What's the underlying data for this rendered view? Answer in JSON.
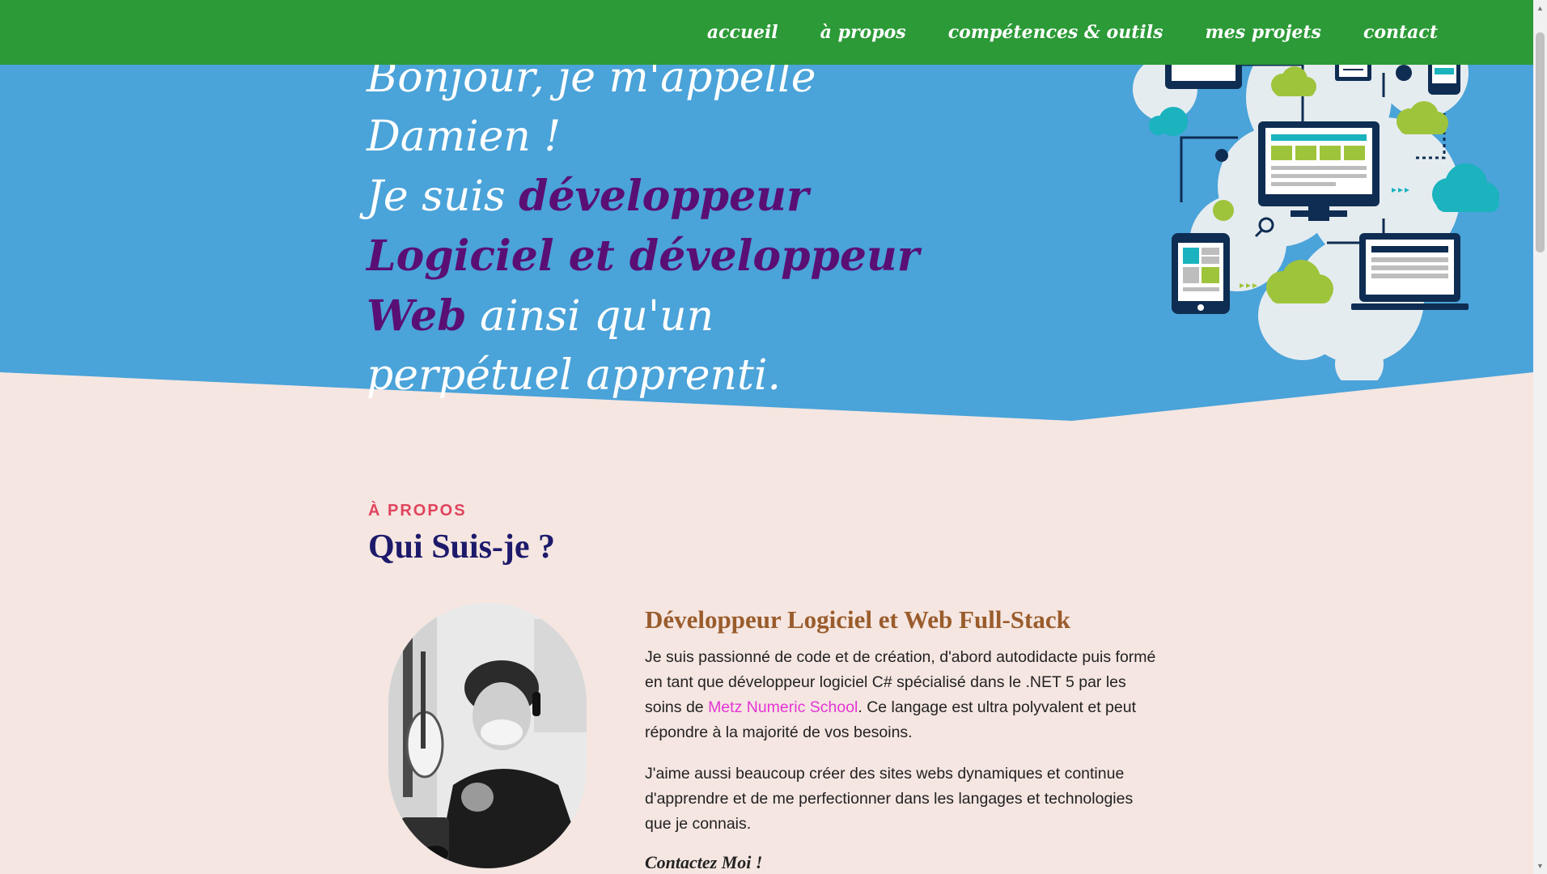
{
  "nav": {
    "items": [
      {
        "label": "accueil"
      },
      {
        "label": "à propos"
      },
      {
        "label": "compétences & outils"
      },
      {
        "label": "mes projets"
      },
      {
        "label": "contact"
      }
    ]
  },
  "hero": {
    "line1": "Bonjour, je m'appelle Damien !",
    "intro": "Je suis ",
    "highlight": "développeur Logiciel et développeur Web",
    "rest": " ainsi qu'un perpétuel apprenti."
  },
  "about": {
    "eyebrow": "À PROPOS",
    "title": "Qui Suis-je ?",
    "subtitle": "Développeur Logiciel et Web Full-Stack",
    "p1_before": "Je suis passionné de code et de création, d'abord autodidacte puis formé en tant que développeur logiciel C# spécialisé dans le .NET 5 par les soins de ",
    "p1_link": "Metz Numeric School",
    "p1_after": ". Ce langage est ultra polyvalent et peut répondre à la majorité de vos besoins.",
    "p2": "J'aime aussi beaucoup créer des sites webs dynamiques et continue d'apprendre et de me perfectionner dans les langages et technologies que je connais.",
    "contact": "Contactez Moi !"
  },
  "colors": {
    "nav_bg": "#2c9a37",
    "hero_bg": "#4aa3d9",
    "page_bg": "#f5e6e1",
    "hero_highlight": "#5a0f74",
    "eyebrow": "#e0445e",
    "title": "#1d1a6b",
    "subtitle": "#9a5c2c",
    "link": "#e535d6"
  },
  "icons": {
    "illustration": "network-devices-illustration",
    "portrait": "profile-photo"
  }
}
